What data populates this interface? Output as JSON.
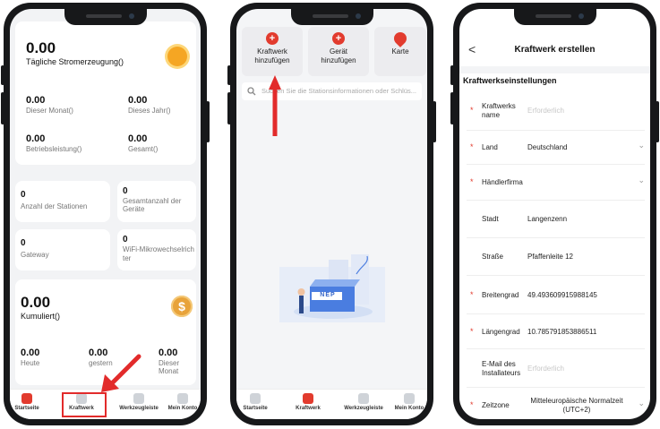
{
  "screen1": {
    "daily_value": "0.00",
    "daily_label": "Tägliche Stromerzeugung()",
    "month_value": "0.00",
    "month_label": "Dieser Monat()",
    "year_value": "0.00",
    "year_label": "Dieses Jahr()",
    "power_value": "0.00",
    "power_label": "Betriebsleistung()",
    "total_value": "0.00",
    "total_label": "Gesamt()",
    "stations_value": "0",
    "stations_label": "Anzahl der Stationen",
    "devices_value": "0",
    "devices_label": "Gesamtanzahl der Geräte",
    "gateway_value": "0",
    "gateway_label": "Gateway",
    "wifi_value": "0",
    "wifi_label": "WiFi-Mikrowechselrichter",
    "cumulative_value": "0.00",
    "cumulative_label": "Kumuliert()",
    "today_value": "0.00",
    "today_label": "Heute",
    "yesterday_value": "0.00",
    "yesterday_label": "gestern",
    "this_month_value": "0.00",
    "this_month_label": "Dieser Monat",
    "coin_symbol": "$"
  },
  "tabs": {
    "home": "Startseite",
    "plant": "Kraftwerk",
    "tools": "Werkzeugleiste",
    "account": "Mein Konto"
  },
  "screen2": {
    "add_plant": "Kraftwerk hinzufügen",
    "add_device": "Gerät hinzufügen",
    "map": "Karte",
    "search_placeholder": "Suchen Sie die Stationsinformationen oder Schlüs...",
    "empty_box_label": "NEP"
  },
  "screen3": {
    "title": "Kraftwerk erstellen",
    "back": "<",
    "section": "Kraftwerkseinstellungen",
    "fields": [
      {
        "key": "Kraftwerks name",
        "value": "Erforderlich",
        "placeholder": true,
        "required": true,
        "dropdown": false
      },
      {
        "key": "Land",
        "value": "Deutschland",
        "placeholder": false,
        "required": true,
        "dropdown": true
      },
      {
        "key": "Händlerfirma",
        "value": "",
        "placeholder": false,
        "required": true,
        "dropdown": true
      },
      {
        "key": "Stadt",
        "value": "Langenzenn",
        "placeholder": false,
        "required": false,
        "dropdown": false
      },
      {
        "key": "Straße",
        "value": "Pfaffenleite 12",
        "placeholder": false,
        "required": false,
        "dropdown": false
      },
      {
        "key": "Breitengrad",
        "value": "49.493609915988145",
        "placeholder": false,
        "required": true,
        "dropdown": false
      },
      {
        "key": "Längengrad",
        "value": "10.785791853886511",
        "placeholder": false,
        "required": true,
        "dropdown": false
      },
      {
        "key": "E-Mail des Installateurs",
        "value": "Erforderlich",
        "placeholder": true,
        "required": false,
        "dropdown": false
      },
      {
        "key": "Zeitzone",
        "value": "Mitteleuropäische Normalzeit (UTC+2)",
        "placeholder": false,
        "required": true,
        "dropdown": true
      }
    ]
  },
  "colors": {
    "accent": "#e23b2e",
    "highlight": "#e22b2b",
    "sun": "#f5a623",
    "coin": "#e8a33a"
  }
}
